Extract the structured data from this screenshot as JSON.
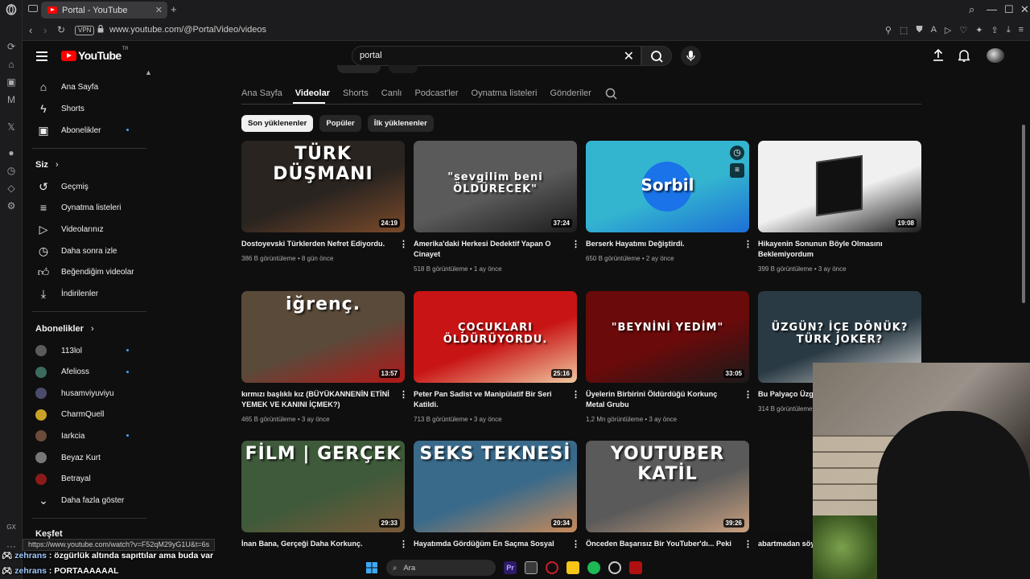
{
  "browser": {
    "tab_title": "Portal - YouTube",
    "url": "www.youtube.com/@PortalVideo/videos",
    "vpn_label": "VPN",
    "status_url": "https://www.youtube.com/watch?v=F52qM29yG1U&t=6s",
    "gx_label": "GX"
  },
  "youtube": {
    "logo_text": "YouTube",
    "logo_tr": "TR",
    "search_query": "portal",
    "sidebar": {
      "main": [
        {
          "label": "Ana Sayfa",
          "icon": "home-icon"
        },
        {
          "label": "Shorts",
          "icon": "shorts-icon"
        },
        {
          "label": "Abonelikler",
          "icon": "subscriptions-icon"
        }
      ],
      "you_header": "Siz",
      "you": [
        {
          "label": "Geçmiş",
          "icon": "history-icon"
        },
        {
          "label": "Oynatma listeleri",
          "icon": "playlists-icon"
        },
        {
          "label": "Videolarınız",
          "icon": "your-videos-icon"
        },
        {
          "label": "Daha sonra izle",
          "icon": "watch-later-icon"
        },
        {
          "label": "Beğendiğim videolar",
          "icon": "liked-icon"
        },
        {
          "label": "İndirilenler",
          "icon": "download-icon"
        }
      ],
      "subs_header": "Abonelikler",
      "subs": [
        {
          "label": "113lol",
          "color": "#5b5b5b",
          "new": true
        },
        {
          "label": "Afelioss",
          "color": "#3a6b5e",
          "new": true
        },
        {
          "label": "husamviyuviyu",
          "color": "#4b4b6b",
          "new": false
        },
        {
          "label": "CharmQuell",
          "color": "#c9a227",
          "new": false
        },
        {
          "label": "Iarkcia",
          "color": "#6b4b3b",
          "new": true
        },
        {
          "label": "Beyaz Kurt",
          "color": "#777777",
          "new": false
        },
        {
          "label": "Betrayal",
          "color": "#8b1a1a",
          "new": false
        }
      ],
      "show_more": "Daha fazla göster",
      "explore_header": "Keşfet"
    },
    "channel_tabs": [
      "Ana Sayfa",
      "Videolar",
      "Shorts",
      "Canlı",
      "Podcast'ler",
      "Oynatma listeleri",
      "Gönderiler"
    ],
    "active_tab": "Videolar",
    "chips": [
      "Son yüklenenler",
      "Popüler",
      "İlk yüklenenler"
    ],
    "videos": [
      {
        "title": "Dostoyevski Türklerden Nefret Ediyordu.",
        "meta": "386 B görüntüleme • 8 gün önce",
        "duration": "24:19",
        "thumb_text": "TÜRK DÜŞMANI",
        "bg": "#2a2420",
        "accent": "#7a4a2a",
        "tcolor": "#ffffff"
      },
      {
        "title": "Amerika'daki Herkesi Dedektif Yapan O Cinayet",
        "meta": "518 B görüntüleme • 1 ay önce",
        "duration": "37:24",
        "thumb_text": "\"sevgilim beni ÖLDÜRECEK\"",
        "bg": "#5a5a5a",
        "accent": "#1c1c1c",
        "tcolor": "#ffffff"
      },
      {
        "title": "Berserk Hayatımı Değiştirdi.",
        "meta": "650 B görüntüleme • 2 ay önce",
        "duration": "",
        "thumb_text": "Sorbil",
        "bg": "#33b5d0",
        "accent": "#1d6fd6",
        "tcolor": "#ffffff"
      },
      {
        "title": "Hikayenin Sonunun Böyle Olmasını Beklemiyordum",
        "meta": "399 B görüntüleme • 3 ay önce",
        "duration": "19:08",
        "thumb_text": "",
        "bg": "#f0f0f0",
        "accent": "#1a1a1a",
        "tcolor": "#000000"
      },
      {
        "title": "kırmızı başlıklı kız (BÜYÜKANNENİN ETİNİ YEMEK VE KANINI İÇMEK?)",
        "meta": "465 B görüntüleme • 3 ay önce",
        "duration": "13:57",
        "thumb_text": "iğrenç.",
        "bg": "#5a4a3a",
        "accent": "#b01818",
        "tcolor": "#ffffff"
      },
      {
        "title": "Peter Pan Sadist ve Manipülatif Bir Seri Katildi.",
        "meta": "713 B görüntüleme • 3 ay önce",
        "duration": "25:16",
        "thumb_text": "ÇOCUKLARI ÖLDÜRÜYORDU.",
        "bg": "#c81414",
        "accent": "#f0c8a0",
        "tcolor": "#ffffff"
      },
      {
        "title": "Üyelerin Birbirini Öldürdüğü Korkunç Metal Grubu",
        "meta": "1,2 Mn görüntüleme • 3 ay önce",
        "duration": "33:05",
        "thumb_text": "\"BEYNİNİ YEDİM\"",
        "bg": "#6a0a0a",
        "accent": "#1a1a1a",
        "tcolor": "#ffffff"
      },
      {
        "title": "Bu Palyaço Üzgü",
        "meta": "314 B görüntüleme",
        "duration": "",
        "thumb_text": "ÜZGÜN? İÇE DÖNÜK? TÜRK JOKER?",
        "bg": "#2a3a44",
        "accent": "#d8d8d8",
        "tcolor": "#ffffff"
      },
      {
        "title": "İnan Bana, Gerçeği Daha Korkunç.",
        "meta": "",
        "duration": "29:33",
        "thumb_text": "FİLM | GERÇEK",
        "bg": "#3e5a3a",
        "accent": "#7a5a3a",
        "tcolor": "#ffffff"
      },
      {
        "title": "Hayatımda Gördüğüm En Saçma Sosyal",
        "meta": "",
        "duration": "20:34",
        "thumb_text": "SEKS TEKNESİ",
        "bg": "#3a6a8a",
        "accent": "#c88a5a",
        "tcolor": "#ffffff"
      },
      {
        "title": "Önceden Başarısız Bir YouTuber'dı... Peki",
        "meta": "",
        "duration": "39:26",
        "thumb_text": "YOUTUBER KATİL",
        "bg": "#5a5a5a",
        "accent": "#c8a080",
        "tcolor": "#ffffff"
      },
      {
        "title": "abartmadan söy",
        "meta": "",
        "duration": "",
        "thumb_text": "",
        "bg": "#101010",
        "accent": "#101010",
        "tcolor": "#ffffff"
      }
    ]
  },
  "chat": [
    {
      "user": "zehrans",
      "text": " : özgürlük altında sapıttılar ama buda var"
    },
    {
      "user": "zehrans",
      "text": " : PORTAAAAAAL"
    }
  ],
  "taskbar": {
    "search_placeholder": "Ara"
  }
}
